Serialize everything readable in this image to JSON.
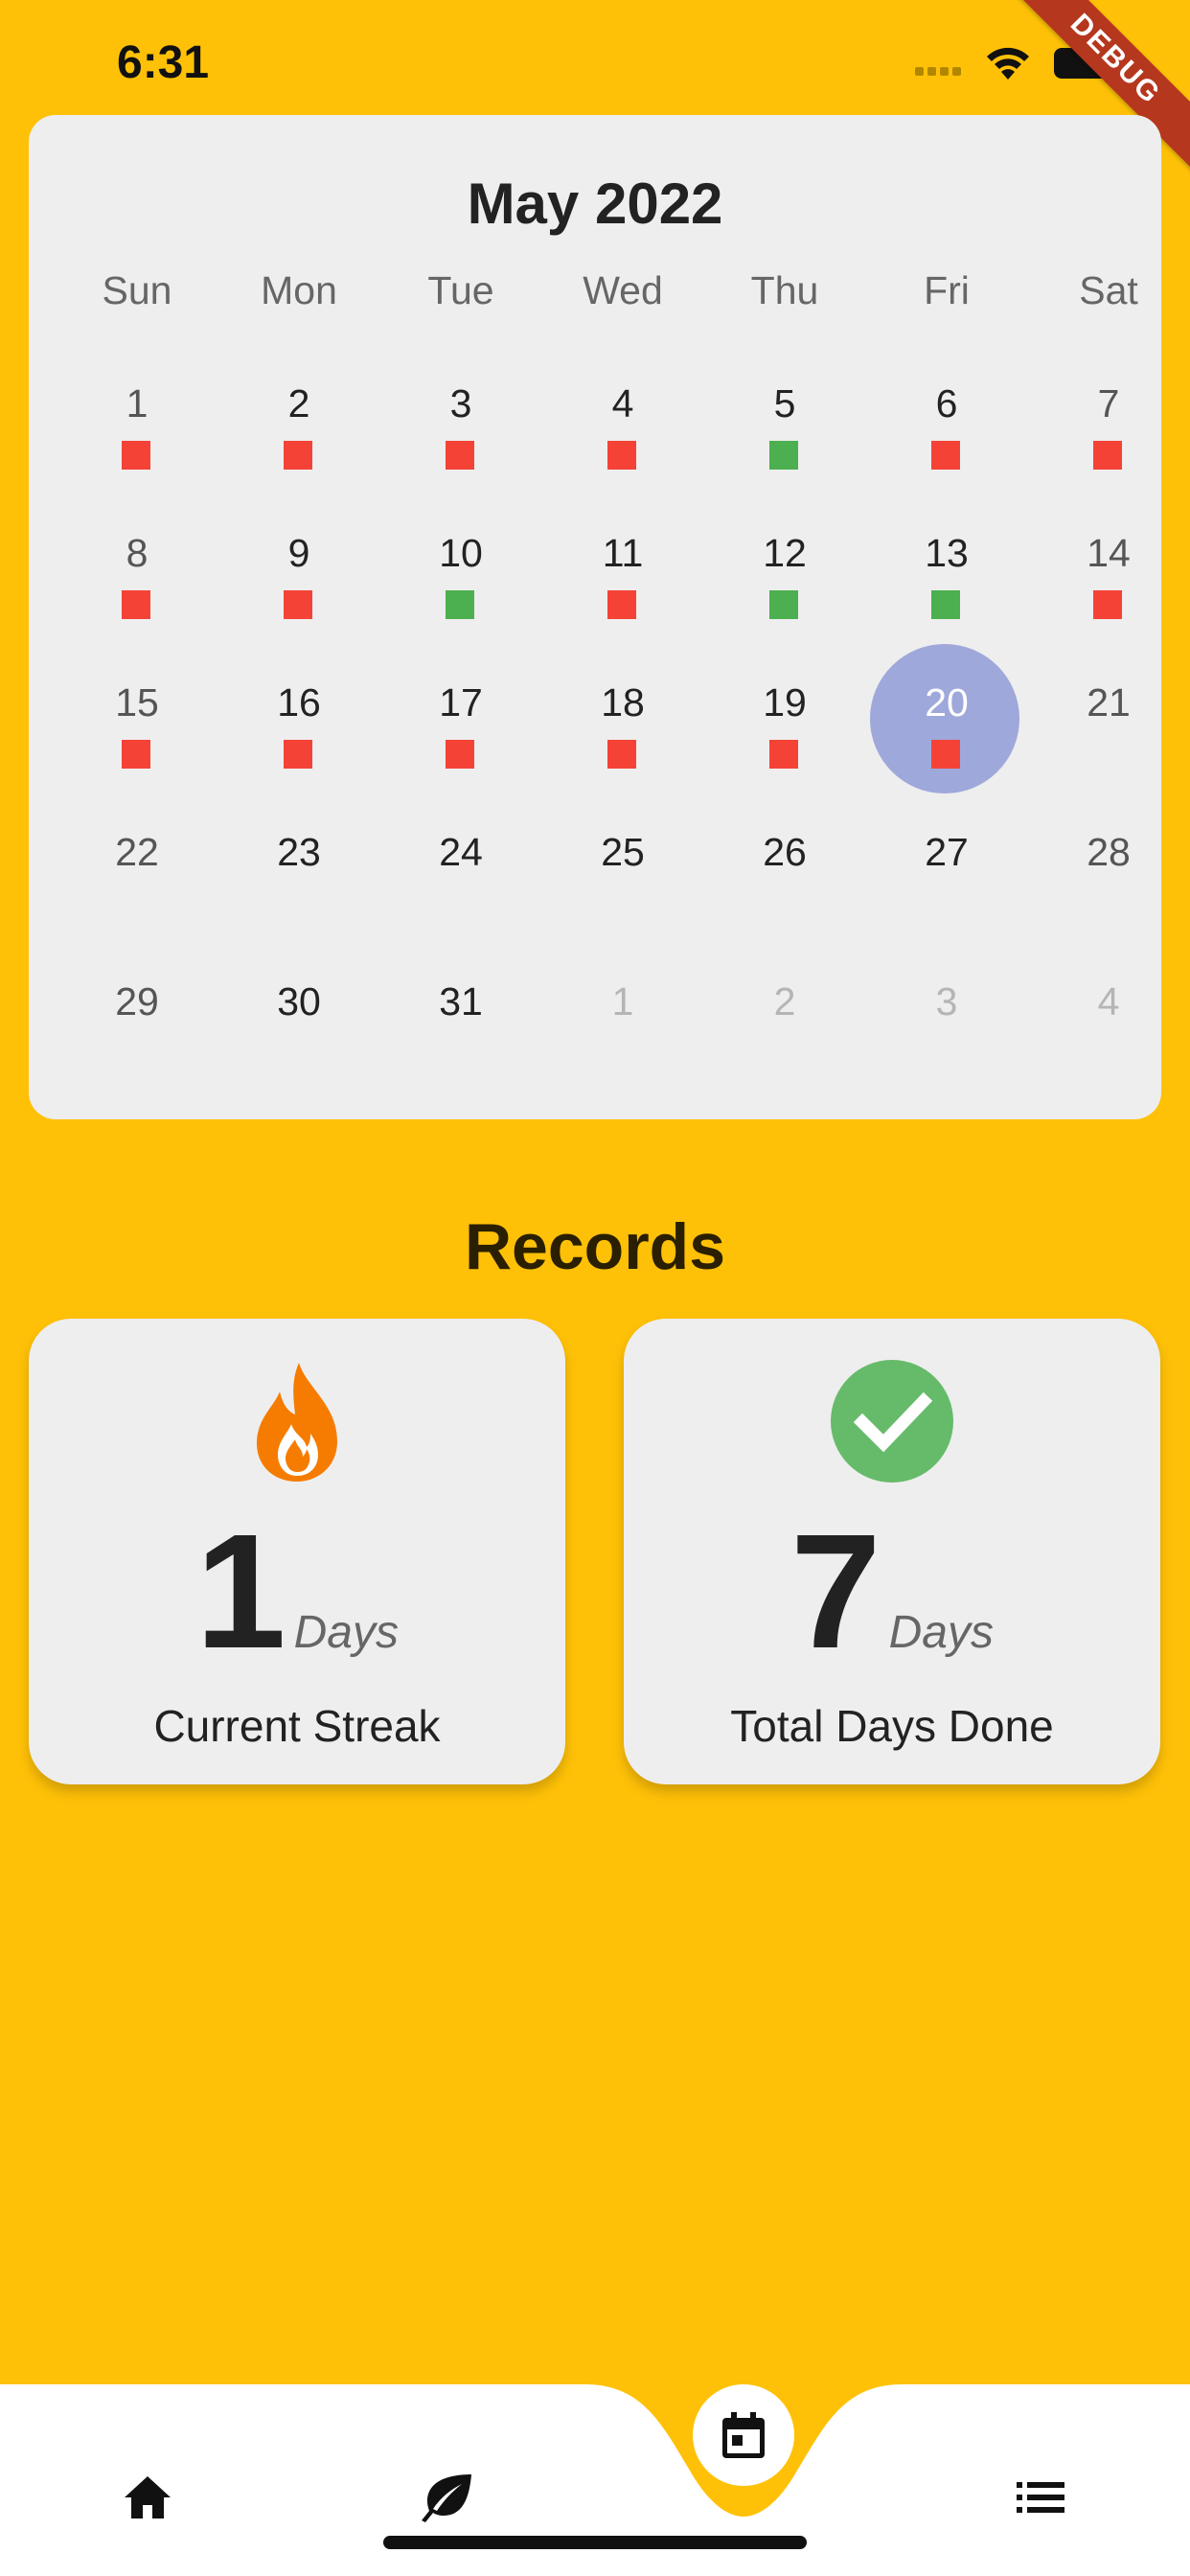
{
  "status_bar": {
    "time": "6:31",
    "debug_label": "DEBUG"
  },
  "calendar": {
    "month_title": "May 2022",
    "weekdays": [
      "Sun",
      "Mon",
      "Tue",
      "Wed",
      "Thu",
      "Fri",
      "Sat"
    ],
    "weeks": [
      [
        {
          "day": "1",
          "marker": "red",
          "weekend": true
        },
        {
          "day": "2",
          "marker": "red"
        },
        {
          "day": "3",
          "marker": "red"
        },
        {
          "day": "4",
          "marker": "red"
        },
        {
          "day": "5",
          "marker": "green"
        },
        {
          "day": "6",
          "marker": "red"
        },
        {
          "day": "7",
          "marker": "red",
          "weekend": true
        }
      ],
      [
        {
          "day": "8",
          "marker": "red",
          "weekend": true
        },
        {
          "day": "9",
          "marker": "red"
        },
        {
          "day": "10",
          "marker": "green"
        },
        {
          "day": "11",
          "marker": "red"
        },
        {
          "day": "12",
          "marker": "green"
        },
        {
          "day": "13",
          "marker": "green"
        },
        {
          "day": "14",
          "marker": "red",
          "weekend": true
        }
      ],
      [
        {
          "day": "15",
          "marker": "red",
          "weekend": true
        },
        {
          "day": "16",
          "marker": "red"
        },
        {
          "day": "17",
          "marker": "red"
        },
        {
          "day": "18",
          "marker": "red"
        },
        {
          "day": "19",
          "marker": "red"
        },
        {
          "day": "20",
          "marker": "red",
          "today": true
        },
        {
          "day": "21",
          "weekend": true
        }
      ],
      [
        {
          "day": "22",
          "weekend": true
        },
        {
          "day": "23"
        },
        {
          "day": "24"
        },
        {
          "day": "25"
        },
        {
          "day": "26"
        },
        {
          "day": "27"
        },
        {
          "day": "28",
          "weekend": true
        }
      ],
      [
        {
          "day": "29",
          "weekend": true
        },
        {
          "day": "30"
        },
        {
          "day": "31"
        },
        {
          "day": "1",
          "outside": true
        },
        {
          "day": "2",
          "outside": true
        },
        {
          "day": "3",
          "outside": true
        },
        {
          "day": "4",
          "outside": true
        }
      ]
    ],
    "colors": {
      "done": "#4CAF50",
      "missed": "#F44336",
      "today": "#9FA8DA"
    }
  },
  "records": {
    "title": "Records",
    "current_streak": {
      "icon": "fire-icon",
      "value": "1",
      "unit": "Days",
      "label": "Current Streak"
    },
    "total_days": {
      "icon": "check-circle-icon",
      "value": "7",
      "unit": "Days",
      "label": "Total Days Done"
    }
  },
  "bottom_nav": {
    "items": [
      {
        "icon": "home-icon"
      },
      {
        "icon": "leaf-icon"
      },
      {
        "icon": "calendar-icon",
        "active": true
      },
      {
        "icon": "list-icon"
      }
    ]
  },
  "theme": {
    "background": "#FFC107",
    "card": "#EEEEEE"
  }
}
